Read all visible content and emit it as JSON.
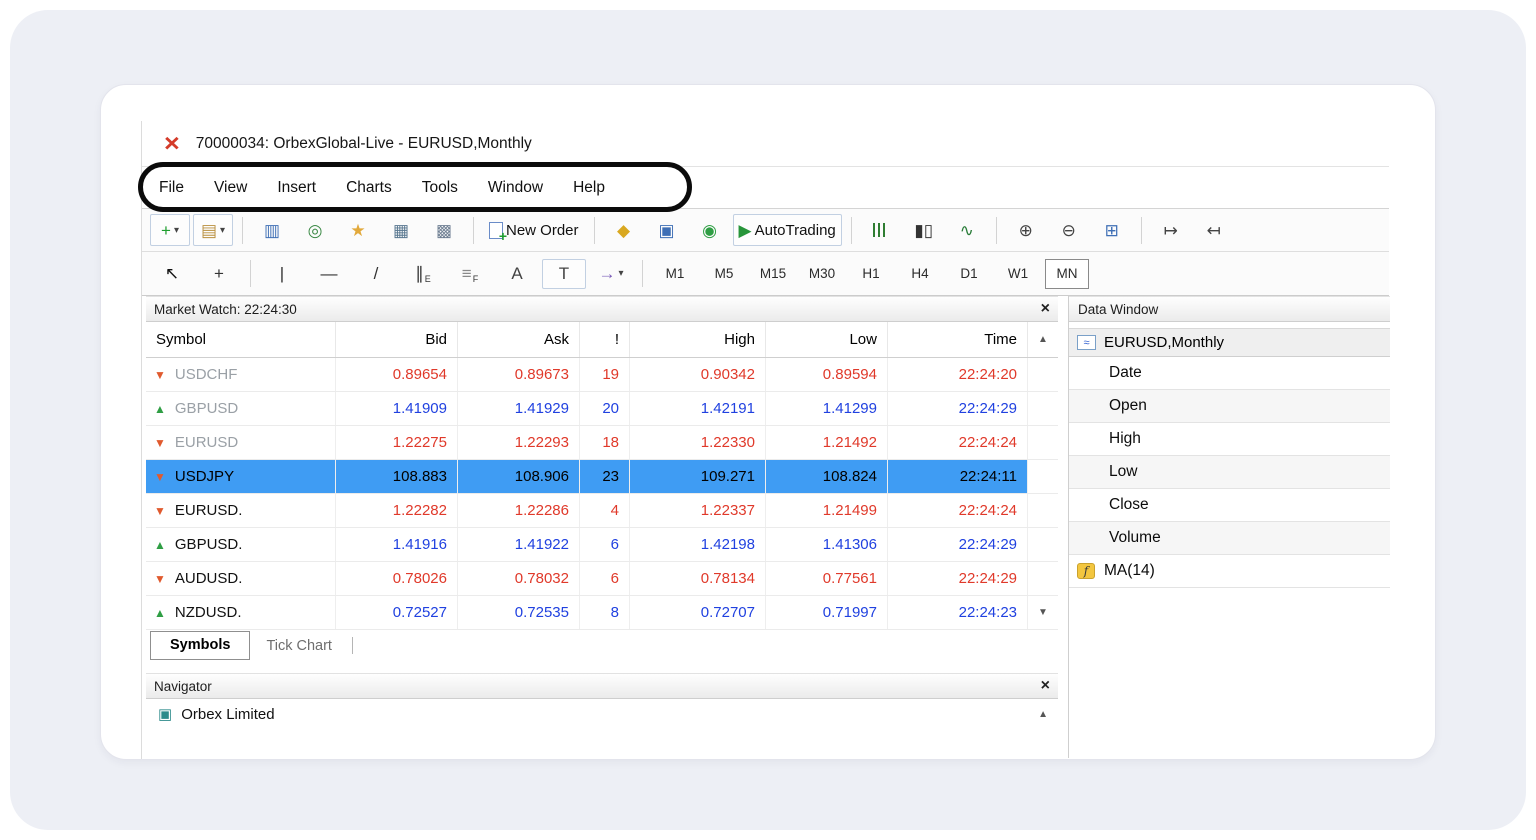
{
  "palette": {
    "price_up_blue": "#2041e0",
    "price_down_red": "#e0392a",
    "selected_row_bg": "#3f9cf3",
    "arrow_up_green": "#2f9e44",
    "arrow_down_red": "#e05a2e",
    "annotation_black": "#0b0b0b",
    "logo_red": "#d43b2a"
  },
  "glyphs": {
    "logo": "×",
    "close": "×",
    "dropdown": "▾",
    "scroll_up": "▲",
    "scroll_down": "▼",
    "arrow_up": "▲",
    "arrow_down": "▼"
  },
  "window": {
    "title": "70000034: OrbexGlobal-Live - EURUSD,Monthly"
  },
  "menu": {
    "items": [
      "File",
      "View",
      "Insert",
      "Charts",
      "Tools",
      "Window",
      "Help"
    ]
  },
  "toolbar_main": {
    "icons": [
      {
        "name": "new-chart-icon",
        "glyph": "+",
        "color": "#1d9e2e",
        "boxed": true,
        "dropdown": true
      },
      {
        "name": "profiles-icon",
        "glyph": "▤",
        "color": "#b98f3e",
        "boxed": true,
        "dropdown": true
      },
      {
        "sep": true
      },
      {
        "name": "market-watch-icon",
        "glyph": "▥",
        "color": "#3f6fb5"
      },
      {
        "name": "data-window-icon",
        "glyph": "◎",
        "color": "#3c8a46"
      },
      {
        "name": "navigator-icon",
        "glyph": "★",
        "color": "#e2a93b"
      },
      {
        "name": "terminal-icon",
        "glyph": "▦",
        "color": "#57768f"
      },
      {
        "name": "strategy-tester-icon",
        "glyph": "▩",
        "color": "#6f7f93"
      },
      {
        "sep": true
      },
      {
        "name": "new-order-icon",
        "shape": "sheet",
        "label": "New Order"
      },
      {
        "sep": true
      },
      {
        "name": "metaeditor-icon",
        "glyph": "◆",
        "color": "#d9a820"
      },
      {
        "name": "expert-advisors-icon",
        "glyph": "▣",
        "color": "#3f6fb5"
      },
      {
        "name": "mql-community-icon",
        "glyph": "◉",
        "color": "#2f9e44"
      },
      {
        "name": "autotrading-icon",
        "glyph": "▶",
        "color": "#27953a",
        "boxed": true,
        "label": "AutoTrading"
      },
      {
        "sep": true
      },
      {
        "name": "bar-chart-icon",
        "shape": "bars"
      },
      {
        "name": "candlestick-chart-icon",
        "glyph": "▮▯",
        "color": "#333333"
      },
      {
        "name": "line-chart-icon",
        "glyph": "∿",
        "color": "#2b7d3a"
      },
      {
        "sep": true
      },
      {
        "name": "zoom-in-icon",
        "glyph": "⊕",
        "color": "#444444"
      },
      {
        "name": "zoom-out-icon",
        "glyph": "⊖",
        "color": "#444444"
      },
      {
        "name": "tile-windows-icon",
        "glyph": "⊞",
        "color": "#3f6fb5"
      },
      {
        "sep": true
      },
      {
        "name": "auto-scroll-icon",
        "glyph": "↦",
        "color": "#444444"
      },
      {
        "name": "chart-shift-icon",
        "glyph": "↤",
        "color": "#444444"
      }
    ]
  },
  "toolbar_drawing": {
    "icons": [
      {
        "name": "cursor-icon",
        "glyph": "↖",
        "color": "#111111"
      },
      {
        "name": "crosshair-icon",
        "glyph": "+",
        "color": "#333333"
      },
      {
        "sep": true
      },
      {
        "name": "vertical-line-icon",
        "glyph": "|",
        "color": "#333333"
      },
      {
        "name": "horizontal-line-icon",
        "glyph": "—",
        "color": "#333333"
      },
      {
        "name": "trendline-icon",
        "glyph": "/",
        "color": "#333333"
      },
      {
        "name": "equidistant-channel-icon",
        "glyph": "∥",
        "sub": "E",
        "color": "#333333"
      },
      {
        "name": "fibonacci-icon",
        "glyph": "≡",
        "sub": "F",
        "color": "#8a8a8a"
      },
      {
        "name": "text-icon",
        "glyph": "A",
        "color": "#444444"
      },
      {
        "name": "text-label-icon",
        "glyph": "T",
        "color": "#444444",
        "boxed": true
      },
      {
        "name": "arrows-icon",
        "glyph": "→",
        "color": "#7a5cb8",
        "dropdown": true
      },
      {
        "sep": true
      }
    ]
  },
  "timeframes": {
    "items": [
      "M1",
      "M5",
      "M15",
      "M30",
      "H1",
      "H4",
      "D1",
      "W1",
      "MN"
    ],
    "selected": "MN"
  },
  "market_watch": {
    "title": "Market Watch: 22:24:30",
    "columns": [
      "Symbol",
      "Bid",
      "Ask",
      "!",
      "High",
      "Low",
      "Time"
    ],
    "rows": [
      {
        "symbol": "USDCHF",
        "arrow": "down",
        "muted": true,
        "trend": "down",
        "selected": false,
        "bid": "0.89654",
        "ask": "0.89673",
        "spread": "19",
        "high": "0.90342",
        "low": "0.89594",
        "time": "22:24:20"
      },
      {
        "symbol": "GBPUSD",
        "arrow": "up",
        "muted": true,
        "trend": "up",
        "selected": false,
        "bid": "1.41909",
        "ask": "1.41929",
        "spread": "20",
        "high": "1.42191",
        "low": "1.41299",
        "time": "22:24:29"
      },
      {
        "symbol": "EURUSD",
        "arrow": "down",
        "muted": true,
        "trend": "down",
        "selected": false,
        "bid": "1.22275",
        "ask": "1.22293",
        "spread": "18",
        "high": "1.22330",
        "low": "1.21492",
        "time": "22:24:24"
      },
      {
        "symbol": "USDJPY",
        "arrow": "down",
        "muted": false,
        "trend": "neutral",
        "selected": true,
        "bid": "108.883",
        "ask": "108.906",
        "spread": "23",
        "high": "109.271",
        "low": "108.824",
        "time": "22:24:11"
      },
      {
        "symbol": "EURUSD.",
        "arrow": "down",
        "muted": false,
        "trend": "down",
        "selected": false,
        "bid": "1.22282",
        "ask": "1.22286",
        "spread": "4",
        "high": "1.22337",
        "low": "1.21499",
        "time": "22:24:24"
      },
      {
        "symbol": "GBPUSD.",
        "arrow": "up",
        "muted": false,
        "trend": "up",
        "selected": false,
        "bid": "1.41916",
        "ask": "1.41922",
        "spread": "6",
        "high": "1.42198",
        "low": "1.41306",
        "time": "22:24:29"
      },
      {
        "symbol": "AUDUSD.",
        "arrow": "down",
        "muted": false,
        "trend": "down",
        "selected": false,
        "bid": "0.78026",
        "ask": "0.78032",
        "spread": "6",
        "high": "0.78134",
        "low": "0.77561",
        "time": "22:24:29"
      },
      {
        "symbol": "NZDUSD.",
        "arrow": "up",
        "muted": false,
        "trend": "up",
        "selected": false,
        "bid": "0.72527",
        "ask": "0.72535",
        "spread": "8",
        "high": "0.72707",
        "low": "0.71997",
        "time": "22:24:23"
      }
    ],
    "tabs": [
      {
        "label": "Symbols",
        "active": true
      },
      {
        "label": "Tick Chart",
        "active": false
      }
    ]
  },
  "navigator": {
    "title": "Navigator",
    "items": [
      {
        "label": "Orbex Limited"
      }
    ]
  },
  "data_window": {
    "title": "Data Window",
    "symbol": "EURUSD,Monthly",
    "fields": [
      "Date",
      "Open",
      "High",
      "Low",
      "Close",
      "Volume"
    ],
    "indicator": "MA(14)"
  }
}
